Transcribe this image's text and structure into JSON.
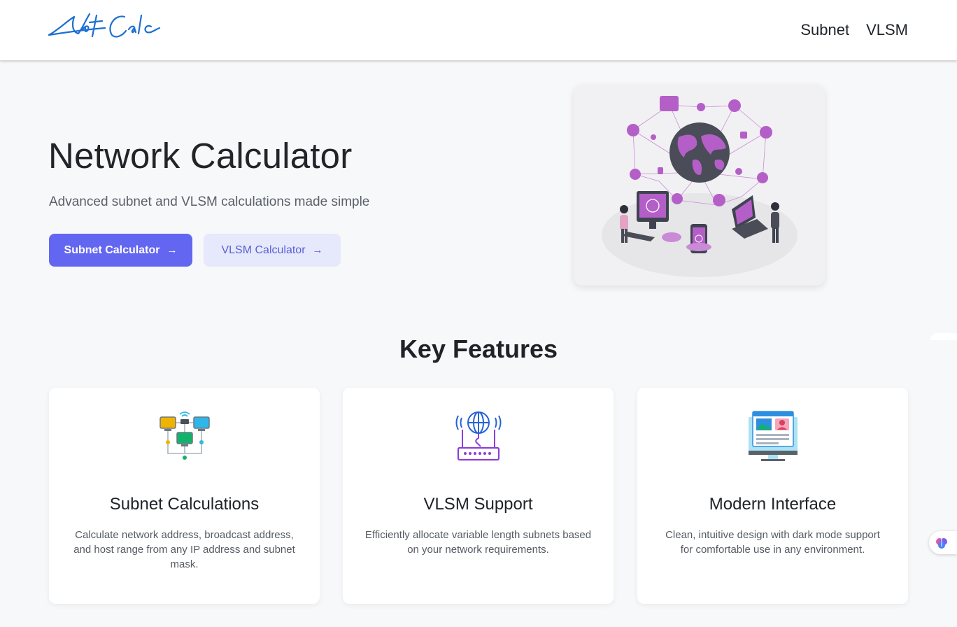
{
  "navbar": {
    "logo_text": "NetCalc",
    "links": [
      "Subnet",
      "VLSM"
    ]
  },
  "hero": {
    "title": "Network Calculator",
    "subtitle": "Advanced subnet and VLSM calculations made simple",
    "primary_button": "Subnet Calculator",
    "secondary_button": "VLSM Calculator",
    "arrow": "→"
  },
  "features": {
    "heading": "Key Features",
    "items": [
      {
        "title": "Subnet Calculations",
        "description": "Calculate network address, broadcast address, and host range from any IP address and subnet mask.",
        "icon": "network-topology-icon"
      },
      {
        "title": "VLSM Support",
        "description": "Efficiently allocate variable length subnets based on your network requirements.",
        "icon": "router-globe-icon"
      },
      {
        "title": "Modern Interface",
        "description": "Clean, intuitive design with dark mode support for comfortable use in any environment.",
        "icon": "monitor-ui-icon"
      }
    ]
  },
  "colors": {
    "primary": "#6366f1",
    "secondary_bg": "#e5e9fb",
    "page_bg": "#f7f8fa",
    "illustration_purple": "#b45fc7"
  }
}
